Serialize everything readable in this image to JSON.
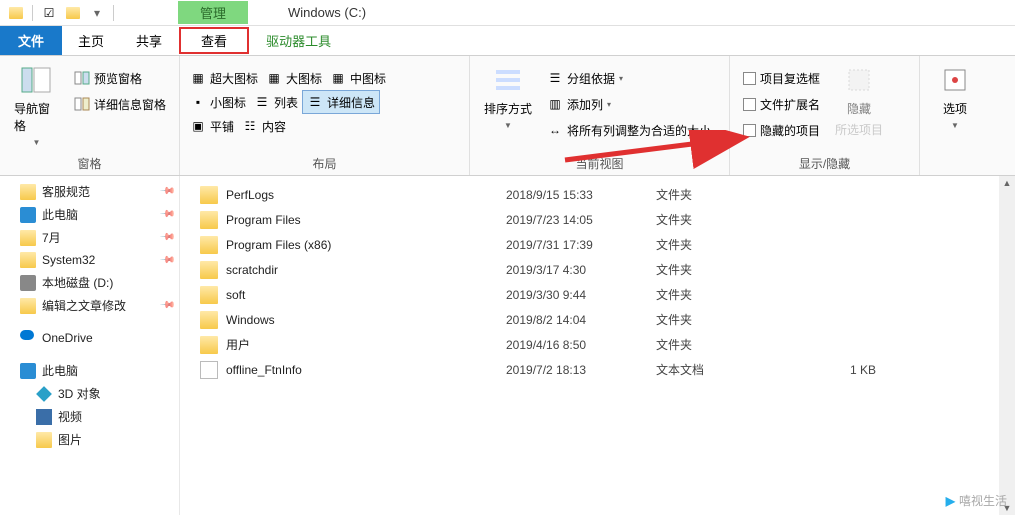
{
  "titlebar": {
    "manage": "管理",
    "window_title": "Windows (C:)"
  },
  "tabs": {
    "file": "文件",
    "home": "主页",
    "share": "共享",
    "view": "查看",
    "tools": "驱动器工具"
  },
  "ribbon": {
    "panes": {
      "nav_pane": "导航窗格",
      "preview_pane": "预览窗格",
      "details_pane": "详细信息窗格",
      "group_label": "窗格"
    },
    "layout": {
      "extra_large": "超大图标",
      "large": "大图标",
      "medium": "中图标",
      "small": "小图标",
      "list": "列表",
      "details": "详细信息",
      "tiles": "平铺",
      "content": "内容",
      "group_label": "布局"
    },
    "current_view": {
      "sort_by": "排序方式",
      "group_by": "分组依据",
      "add_columns": "添加列",
      "size_all": "将所有列调整为合适的大小",
      "group_label": "当前视图"
    },
    "show_hide": {
      "item_checkboxes": "项目复选框",
      "file_ext": "文件扩展名",
      "hidden_items": "隐藏的项目",
      "hide_selected": "隐藏",
      "hide_selected_sub": "所选项目",
      "group_label": "显示/隐藏"
    },
    "options": {
      "label": "选项"
    }
  },
  "sidebar": {
    "items": [
      {
        "label": "客服规范",
        "icon": "folder",
        "pinned": true
      },
      {
        "label": "此电脑",
        "icon": "monitor",
        "pinned": true
      },
      {
        "label": "7月",
        "icon": "folder",
        "pinned": true
      },
      {
        "label": "System32",
        "icon": "folder",
        "pinned": true
      },
      {
        "label": "本地磁盘 (D:)",
        "icon": "drive",
        "pinned": false
      },
      {
        "label": "编辑之文章修改",
        "icon": "folder",
        "pinned": true
      }
    ],
    "onedrive": "OneDrive",
    "this_pc": "此电脑",
    "children": [
      {
        "label": "3D 对象",
        "icon": "cube"
      },
      {
        "label": "视频",
        "icon": "video"
      },
      {
        "label": "图片",
        "icon": "folder"
      }
    ]
  },
  "files": [
    {
      "name": "PerfLogs",
      "date": "2018/9/15 15:33",
      "type": "文件夹",
      "size": "",
      "icon": "folder"
    },
    {
      "name": "Program Files",
      "date": "2019/7/23 14:05",
      "type": "文件夹",
      "size": "",
      "icon": "folder"
    },
    {
      "name": "Program Files (x86)",
      "date": "2019/7/31 17:39",
      "type": "文件夹",
      "size": "",
      "icon": "folder"
    },
    {
      "name": "scratchdir",
      "date": "2019/3/17 4:30",
      "type": "文件夹",
      "size": "",
      "icon": "folder"
    },
    {
      "name": "soft",
      "date": "2019/3/30 9:44",
      "type": "文件夹",
      "size": "",
      "icon": "folder"
    },
    {
      "name": "Windows",
      "date": "2019/8/2 14:04",
      "type": "文件夹",
      "size": "",
      "icon": "folder"
    },
    {
      "name": "用户",
      "date": "2019/4/16 8:50",
      "type": "文件夹",
      "size": "",
      "icon": "folder"
    },
    {
      "name": "offline_FtnInfo",
      "date": "2019/7/2 18:13",
      "type": "文本文档",
      "size": "1 KB",
      "icon": "file"
    }
  ],
  "watermark": "嘻视生活"
}
